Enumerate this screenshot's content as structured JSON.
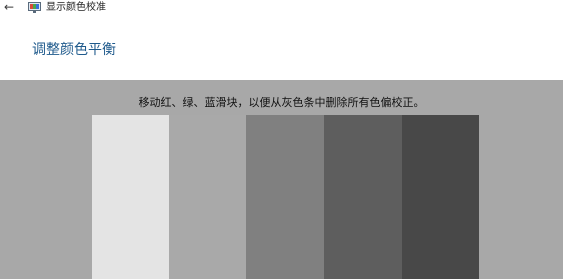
{
  "window": {
    "back_icon": "back-arrow-icon",
    "app_icon": "display-color-calibration-icon",
    "title": "显示颜色校准"
  },
  "page": {
    "heading": "调整颜色平衡",
    "instruction": "移动红、绿、蓝滑块，以便从灰色条中删除所有色偏校正。",
    "background_color": "#a8a8a8"
  },
  "gray_bars": [
    {
      "color": "#e4e4e4"
    },
    {
      "color": "#a9a9a9"
    },
    {
      "color": "#808080"
    },
    {
      "color": "#5e5e5e"
    },
    {
      "color": "#484848"
    }
  ]
}
